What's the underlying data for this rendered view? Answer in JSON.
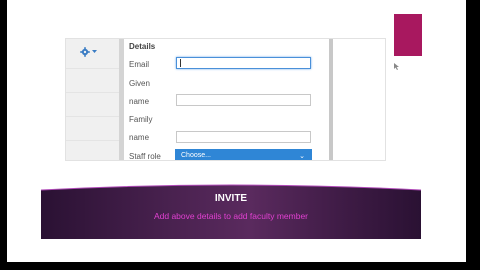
{
  "colors": {
    "accent_pink": "#a8185f",
    "select_blue": "#2f86d6",
    "focus_border": "#4a90d9",
    "banner_purple": "#4a2250",
    "subtitle_magenta": "#e040d0"
  },
  "toolbar": {
    "settings_icon": "gear-icon",
    "dropdown_icon": "caret-down-icon"
  },
  "form": {
    "heading": "Details",
    "email_label": "Email",
    "email_value": "",
    "given_label_1": "Given",
    "given_label_2": "name",
    "given_value": "",
    "family_label_1": "Family",
    "family_label_2": "name",
    "family_value": "",
    "staff_role_label": "Staff role",
    "staff_role_value": "Choose...",
    "staff_role_chevron": "⌄"
  },
  "banner": {
    "title": "INVITE",
    "subtitle": "Add above details to add faculty member"
  }
}
